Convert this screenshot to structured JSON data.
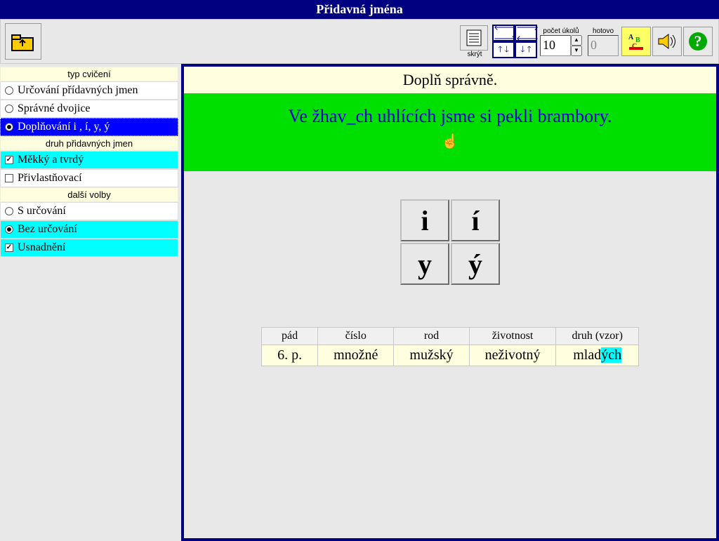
{
  "title": "Přidavná jména",
  "toolbar": {
    "skryt_label": "skrýt",
    "pocet_label": "počet úkolů",
    "pocet_value": "10",
    "hotovo_label": "hotovo",
    "hotovo_value": "0"
  },
  "sidebar": {
    "group1_header": "typ cvičení",
    "group1": [
      {
        "label": "Určování přídavných jmen",
        "type": "radio",
        "on": false,
        "sel": ""
      },
      {
        "label": "Správné dvojice",
        "type": "radio",
        "on": false,
        "sel": ""
      },
      {
        "label": "Doplňování i , í, y, ý",
        "type": "radio",
        "on": true,
        "sel": "blue"
      }
    ],
    "group2_header": "druh přidavných jmen",
    "group2": [
      {
        "label": "Měkký a tvrdý",
        "type": "check",
        "on": true,
        "sel": "cyan"
      },
      {
        "label": "Přivlastňovací",
        "type": "check",
        "on": false,
        "sel": ""
      }
    ],
    "group3_header": "další volby",
    "group3": [
      {
        "label": "S určování",
        "type": "radio",
        "on": false,
        "sel": ""
      },
      {
        "label": "Bez určování",
        "type": "radio",
        "on": true,
        "sel": "cyan"
      },
      {
        "label": "Usnadnění",
        "type": "check",
        "on": true,
        "sel": "cyan"
      }
    ]
  },
  "main": {
    "instruction": "Doplň správně.",
    "sentence_pre": "Ve žhav",
    "sentence_blank": "_",
    "sentence_post": "ch uhlících jsme si pekli brambory.",
    "letters": [
      "i",
      "í",
      "y",
      "ý"
    ],
    "table": {
      "headers": [
        "pád",
        "číslo",
        "rod",
        "životnost",
        "druh (vzor)"
      ],
      "values": [
        "6. p.",
        "množné",
        "mužský",
        "neživotný"
      ],
      "last_value_pre": "mlad",
      "last_value_hl": "ých"
    }
  }
}
